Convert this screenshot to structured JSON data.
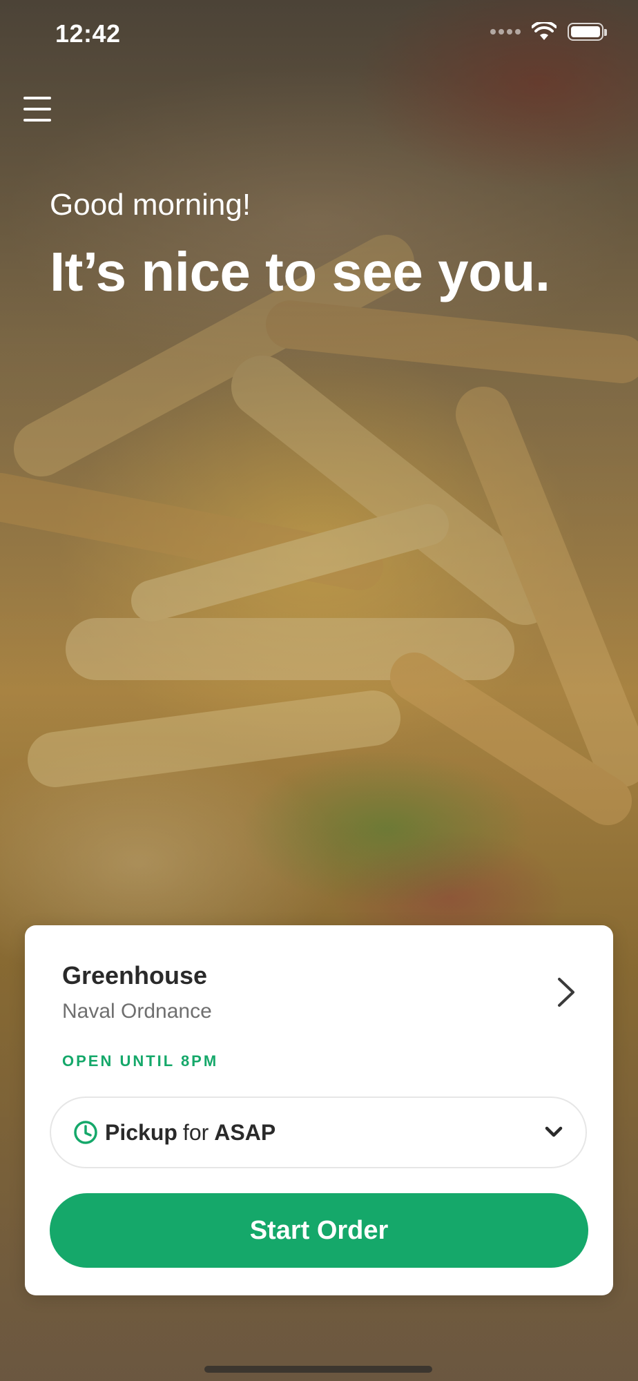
{
  "status_bar": {
    "time": "12:42",
    "icons": [
      "signal-icon",
      "wifi-icon",
      "battery-icon"
    ]
  },
  "header": {
    "menu_icon": "hamburger-menu-icon"
  },
  "hero": {
    "greeting": "Good morning!",
    "headline": "It’s nice to see you."
  },
  "location": {
    "name": "Greenhouse",
    "subtitle": "Naval Ordnance",
    "status": "OPEN UNTIL 8PM"
  },
  "order_options": {
    "mode": "Pickup",
    "connector": "for",
    "time": "ASAP"
  },
  "actions": {
    "start_order_label": "Start Order"
  },
  "colors": {
    "accent": "#15a86a",
    "card": "#ffffff",
    "text_primary": "#2a2a2a",
    "text_secondary": "#6f6f6f"
  }
}
